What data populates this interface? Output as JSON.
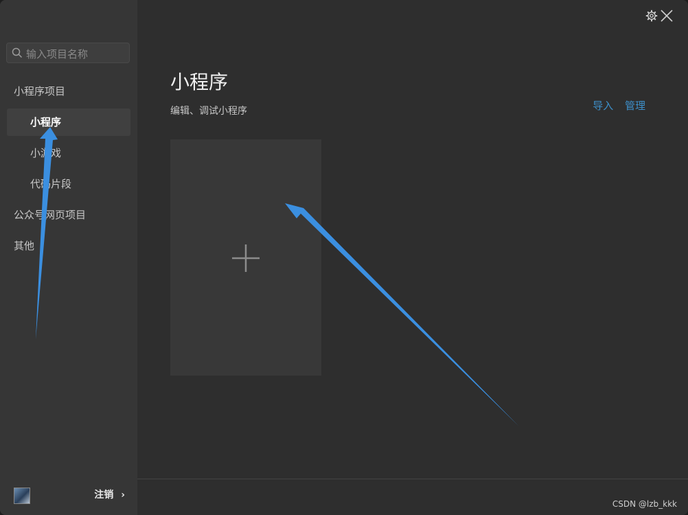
{
  "sidebar": {
    "search_placeholder": "输入项目名称",
    "items": [
      {
        "label": "小程序项目",
        "kind": "group"
      },
      {
        "label": "小程序",
        "kind": "sub",
        "active": true
      },
      {
        "label": "小游戏",
        "kind": "sub"
      },
      {
        "label": "代码片段",
        "kind": "sub"
      },
      {
        "label": "公众号网页项目",
        "kind": "group"
      },
      {
        "label": "其他",
        "kind": "group"
      }
    ],
    "logout_label": "注销",
    "logout_chevron": "›"
  },
  "main": {
    "title": "小程序",
    "subtitle": "编辑、调试小程序",
    "import_label": "导入",
    "manage_label": "管理",
    "new_card_icon": "plus-icon"
  },
  "watermark": "CSDN @lzb_kkk",
  "colors": {
    "accent_link": "#3d8fc9",
    "arrow": "#3b8fe0",
    "sidebar_bg": "#363636",
    "main_bg": "#2e2e2e"
  }
}
